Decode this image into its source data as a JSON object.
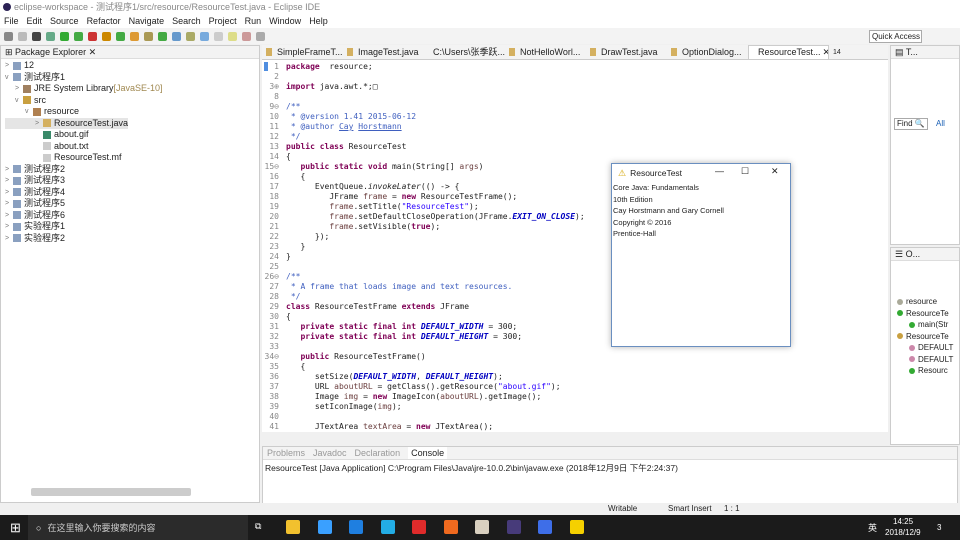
{
  "window": {
    "title": "eclipse-workspace - 测试程序1/src/resource/ResourceTest.java - Eclipse IDE"
  },
  "menu": [
    "File",
    "Edit",
    "Source",
    "Refactor",
    "Navigate",
    "Search",
    "Project",
    "Run",
    "Window",
    "Help"
  ],
  "toolbar": {
    "quick_access": "Quick Access"
  },
  "package_explorer": {
    "title": "Package Explorer",
    "items": [
      {
        "label": "12",
        "depth": 0,
        "twisty": ">",
        "icon": "project-icon"
      },
      {
        "label": "测试程序1",
        "depth": 0,
        "twisty": "v",
        "icon": "project-icon"
      },
      {
        "label": "JRE System Library",
        "suffix": " [JavaSE-10]",
        "depth": 1,
        "twisty": ">",
        "icon": "library-icon"
      },
      {
        "label": "src",
        "depth": 1,
        "twisty": "v",
        "icon": "source-folder-icon"
      },
      {
        "label": "resource",
        "depth": 2,
        "twisty": "v",
        "icon": "package-icon"
      },
      {
        "label": "ResourceTest.java",
        "depth": 3,
        "twisty": ">",
        "icon": "java-file-icon",
        "selected": true
      },
      {
        "label": "about.gif",
        "depth": 3,
        "twisty": "",
        "icon": "image-file-icon"
      },
      {
        "label": "about.txt",
        "depth": 3,
        "twisty": "",
        "icon": "text-file-icon"
      },
      {
        "label": "ResourceTest.mf",
        "depth": 3,
        "twisty": "",
        "icon": "text-file-icon"
      },
      {
        "label": "测试程序2",
        "depth": 0,
        "twisty": ">",
        "icon": "project-icon"
      },
      {
        "label": "测试程序3",
        "depth": 0,
        "twisty": ">",
        "icon": "project-icon"
      },
      {
        "label": "测试程序4",
        "depth": 0,
        "twisty": ">",
        "icon": "project-icon"
      },
      {
        "label": "测试程序5",
        "depth": 0,
        "twisty": ">",
        "icon": "project-icon"
      },
      {
        "label": "测试程序6",
        "depth": 0,
        "twisty": ">",
        "icon": "project-icon"
      },
      {
        "label": "实验程序1",
        "depth": 0,
        "twisty": ">",
        "icon": "project-icon"
      },
      {
        "label": "实验程序2",
        "depth": 0,
        "twisty": ">",
        "icon": "project-icon"
      }
    ]
  },
  "editor": {
    "tabs": [
      "SimpleFrameT...",
      "ImageTest.java",
      "C:\\Users\\张季跃...",
      "NotHelloWorl...",
      "DrawTest.java",
      "OptionDialog...",
      "ResourceTest..."
    ],
    "active_tab": 6,
    "overflow": "14",
    "lines": [
      {
        "n": "1",
        "t": [
          [
            "kw",
            "package"
          ],
          [
            "",
            "  resource;"
          ]
        ]
      },
      {
        "n": "2",
        "t": []
      },
      {
        "n": "3⊕",
        "t": [
          [
            "kw",
            "import"
          ],
          [
            "",
            " java.awt.*;□"
          ]
        ]
      },
      {
        "n": "8",
        "t": []
      },
      {
        "n": "9⊖",
        "t": [
          [
            "cmt",
            "/**"
          ]
        ]
      },
      {
        "n": "10",
        "t": [
          [
            "cmt",
            " * @version 1.41 2015-06-12"
          ]
        ]
      },
      {
        "n": "11",
        "t": [
          [
            "cmt",
            " * @author "
          ],
          [
            "lnk",
            "Cay"
          ],
          [
            "cmt",
            " "
          ],
          [
            "lnk",
            "Horstmann"
          ]
        ]
      },
      {
        "n": "12",
        "t": [
          [
            "cmt",
            " */"
          ]
        ]
      },
      {
        "n": "13",
        "t": [
          [
            "kw",
            "public class"
          ],
          [
            "",
            " ResourceTest"
          ]
        ]
      },
      {
        "n": "14",
        "t": [
          [
            "",
            "{"
          ]
        ]
      },
      {
        "n": "15⊖",
        "t": [
          [
            "",
            "   "
          ],
          [
            "kw",
            "public static void"
          ],
          [
            "",
            " main(String[] "
          ],
          [
            "var",
            "args"
          ],
          [
            "",
            ")"
          ]
        ]
      },
      {
        "n": "16",
        "t": [
          [
            "",
            "   {"
          ]
        ]
      },
      {
        "n": "17",
        "t": [
          [
            "",
            "      EventQueue."
          ],
          [
            "fldi",
            "invokeLater"
          ],
          [
            "",
            "(() -> {"
          ]
        ]
      },
      {
        "n": "18",
        "t": [
          [
            "",
            "         JFrame "
          ],
          [
            "var",
            "frame"
          ],
          [
            "",
            " = "
          ],
          [
            "kw",
            "new"
          ],
          [
            "",
            " ResourceTestFrame();"
          ]
        ]
      },
      {
        "n": "19",
        "t": [
          [
            "var",
            "         frame"
          ],
          [
            "",
            ".setTitle("
          ],
          [
            "str",
            "\"ResourceTest\""
          ],
          [
            "",
            ");"
          ]
        ]
      },
      {
        "n": "20",
        "t": [
          [
            "var",
            "         frame"
          ],
          [
            "",
            ".setDefaultCloseOperation(JFrame."
          ],
          [
            "fld",
            "EXIT_ON_CLOSE"
          ],
          [
            "",
            ");"
          ]
        ]
      },
      {
        "n": "21",
        "t": [
          [
            "var",
            "         frame"
          ],
          [
            "",
            ".setVisible("
          ],
          [
            "kw",
            "true"
          ],
          [
            "",
            ");"
          ]
        ]
      },
      {
        "n": "22",
        "t": [
          [
            "",
            "      });"
          ]
        ]
      },
      {
        "n": "23",
        "t": [
          [
            "",
            "   }"
          ]
        ]
      },
      {
        "n": "24",
        "t": [
          [
            "",
            "}"
          ]
        ]
      },
      {
        "n": "25",
        "t": []
      },
      {
        "n": "26⊖",
        "t": [
          [
            "cmt",
            "/**"
          ]
        ]
      },
      {
        "n": "27",
        "t": [
          [
            "cmt",
            " * A frame that loads image and text resources."
          ]
        ]
      },
      {
        "n": "28",
        "t": [
          [
            "cmt",
            " */"
          ]
        ]
      },
      {
        "n": "29",
        "t": [
          [
            "kw",
            "class"
          ],
          [
            "",
            " ResourceTestFrame "
          ],
          [
            "kw",
            "extends"
          ],
          [
            "",
            " JFrame"
          ]
        ]
      },
      {
        "n": "30",
        "t": [
          [
            "",
            "{"
          ]
        ]
      },
      {
        "n": "31",
        "t": [
          [
            "",
            "   "
          ],
          [
            "kw",
            "private static final int"
          ],
          [
            "",
            " "
          ],
          [
            "fld",
            "DEFAULT_WIDTH"
          ],
          [
            "",
            " = 300;"
          ]
        ]
      },
      {
        "n": "32",
        "t": [
          [
            "",
            "   "
          ],
          [
            "kw",
            "private static final int"
          ],
          [
            "",
            " "
          ],
          [
            "fld",
            "DEFAULT_HEIGHT"
          ],
          [
            "",
            " = 300;"
          ]
        ]
      },
      {
        "n": "33",
        "t": []
      },
      {
        "n": "34⊖",
        "t": [
          [
            "",
            "   "
          ],
          [
            "kw",
            "public"
          ],
          [
            "",
            " ResourceTestFrame()"
          ]
        ]
      },
      {
        "n": "35",
        "t": [
          [
            "",
            "   {"
          ]
        ]
      },
      {
        "n": "36",
        "t": [
          [
            "",
            "      setSize("
          ],
          [
            "fld",
            "DEFAULT_WIDTH"
          ],
          [
            "",
            ", "
          ],
          [
            "fld",
            "DEFAULT_HEIGHT"
          ],
          [
            "",
            ");"
          ]
        ]
      },
      {
        "n": "37",
        "t": [
          [
            "",
            "      URL "
          ],
          [
            "var",
            "aboutURL"
          ],
          [
            "",
            " = getClass().getResource("
          ],
          [
            "str",
            "\"about.gif\""
          ],
          [
            "",
            ");"
          ]
        ]
      },
      {
        "n": "38",
        "t": [
          [
            "",
            "      Image "
          ],
          [
            "var",
            "img"
          ],
          [
            "",
            " = "
          ],
          [
            "kw",
            "new"
          ],
          [
            "",
            " ImageIcon("
          ],
          [
            "var",
            "aboutURL"
          ],
          [
            "",
            ").getImage();"
          ]
        ]
      },
      {
        "n": "39",
        "t": [
          [
            "",
            "      setIconImage("
          ],
          [
            "var",
            "img"
          ],
          [
            "",
            ");"
          ]
        ]
      },
      {
        "n": "40",
        "t": []
      },
      {
        "n": "41",
        "t": [
          [
            "",
            "      JTextArea "
          ],
          [
            "var",
            "textArea"
          ],
          [
            "",
            " = "
          ],
          [
            "kw",
            "new"
          ],
          [
            "",
            " JTextArea();"
          ]
        ]
      }
    ]
  },
  "task_list": {
    "title": "T...",
    "find": "Find",
    "all": "All"
  },
  "outline": {
    "title": "O...",
    "items": [
      {
        "label": "resource",
        "depth": 0
      },
      {
        "label": "ResourceTe",
        "depth": 0
      },
      {
        "label": "main(Str",
        "depth": 1
      },
      {
        "label": "ResourceTe",
        "depth": 0
      },
      {
        "label": "DEFAULT",
        "depth": 1
      },
      {
        "label": "DEFAULT",
        "depth": 1
      },
      {
        "label": "Resourc",
        "depth": 1
      }
    ]
  },
  "swing_window": {
    "title": "ResourceTest",
    "lines": [
      "Core Java: Fundamentals",
      "10th Edition",
      "Cay Horstmann and Gary Cornell",
      "Copyright © 2016",
      "Prentice-Hall"
    ]
  },
  "console": {
    "tabs": [
      "Problems",
      "Javadoc",
      "Declaration",
      "Console"
    ],
    "active_tab": 3,
    "text": "ResourceTest [Java Application] C:\\Program Files\\Java\\jre-10.0.2\\bin\\javaw.exe (2018年12月9日 下午2:24:37)"
  },
  "status": {
    "writable": "Writable",
    "insert_mode": "Smart Insert",
    "position": "1 : 1"
  },
  "taskbar": {
    "search_placeholder": "在这里输入你要搜索的内容",
    "time": "14:25",
    "date": "2018/12/9",
    "ime": "英",
    "notifications": "3",
    "apps": [
      {
        "name": "file-explorer-icon",
        "color": "#f2c12e"
      },
      {
        "name": "browser-q-icon",
        "color": "#3aa0ff"
      },
      {
        "name": "edge-icon",
        "color": "#1f7fe0"
      },
      {
        "name": "bilibili-icon",
        "color": "#23ade5"
      },
      {
        "name": "netease-music-icon",
        "color": "#e02b2b"
      },
      {
        "name": "app-orange-icon",
        "color": "#f06a1f"
      },
      {
        "name": "app-doc-icon",
        "color": "#d9d0c0"
      },
      {
        "name": "eclipse-icon",
        "color": "#473b7a"
      },
      {
        "name": "wps-icon",
        "color": "#3e6ee8"
      },
      {
        "name": "java-warning-icon",
        "color": "#f5d000"
      }
    ]
  }
}
